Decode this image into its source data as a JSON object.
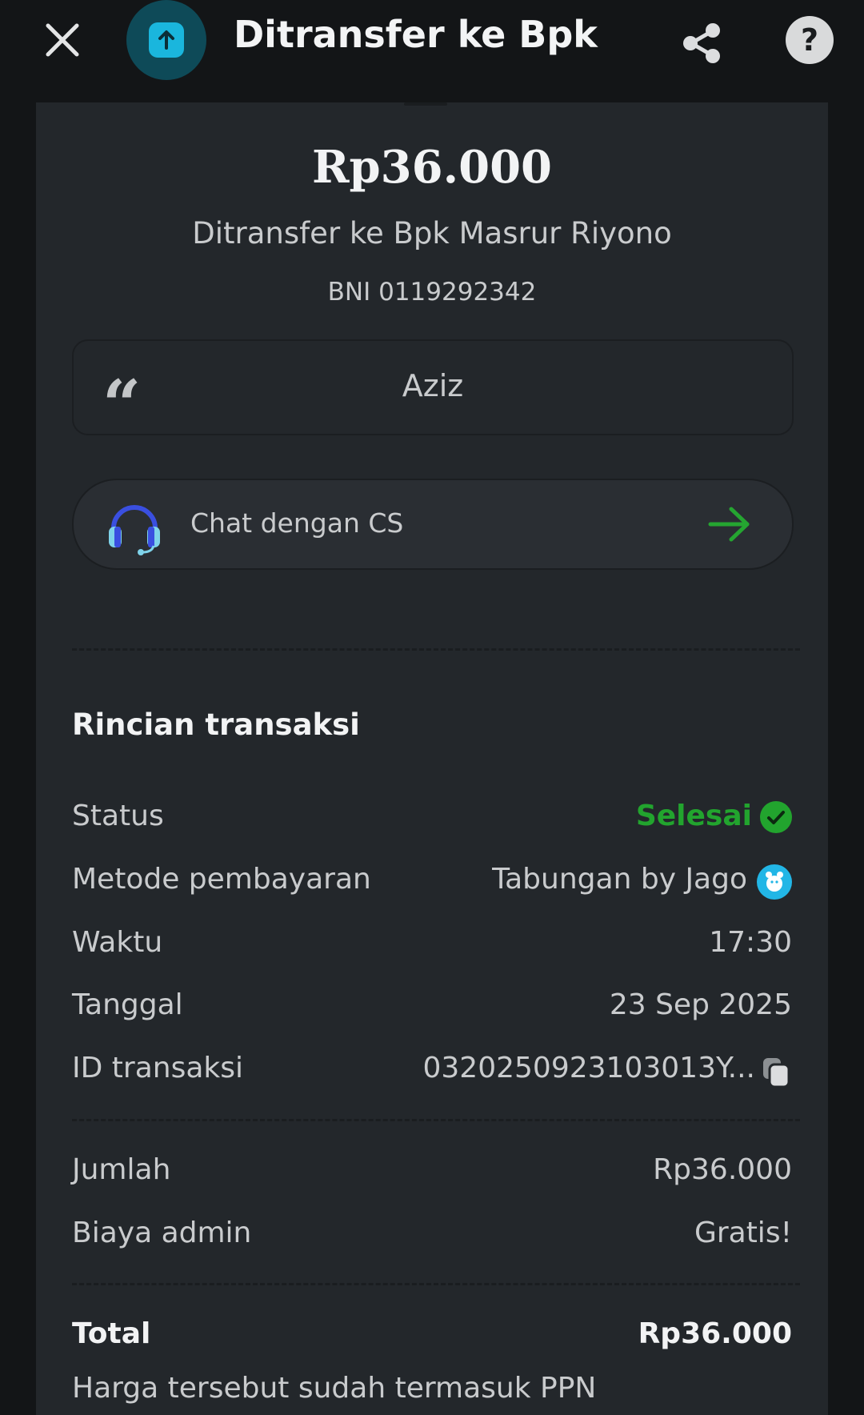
{
  "header": {
    "title": "Ditransfer ke Bpk ...",
    "close_icon": "close-icon",
    "avatar_icon": "arrow-up-icon",
    "share_icon": "share-icon",
    "help_label": "?"
  },
  "summary": {
    "amount": "Rp36.000",
    "recipient": "Ditransfer ke Bpk Masrur Riyono",
    "account": "BNI 0119292342",
    "note": "Aziz"
  },
  "cs": {
    "label": "Chat dengan CS"
  },
  "details": {
    "title": "Rincian transaksi",
    "rows": [
      {
        "label": "Status",
        "value": "Selesai"
      },
      {
        "label": "Metode pembayaran",
        "value": "Tabungan by Jago"
      },
      {
        "label": "Waktu",
        "value": "17:30"
      },
      {
        "label": "Tanggal",
        "value": "23 Sep 2025"
      },
      {
        "label": "ID transaksi",
        "value": "0320250923103013Y..."
      }
    ]
  },
  "totals": {
    "rows": [
      {
        "label": "Jumlah",
        "value": "Rp36.000"
      },
      {
        "label": "Biaya admin",
        "value": "Gratis!"
      }
    ],
    "total_label": "Total",
    "total_value": "Rp36.000"
  },
  "footer": {
    "text": "Harga tersebut sudah termasuk PPN"
  },
  "colors": {
    "background": "#131517",
    "card": "#23272b",
    "success": "#22a42e",
    "accent": "#1ab6dd"
  }
}
